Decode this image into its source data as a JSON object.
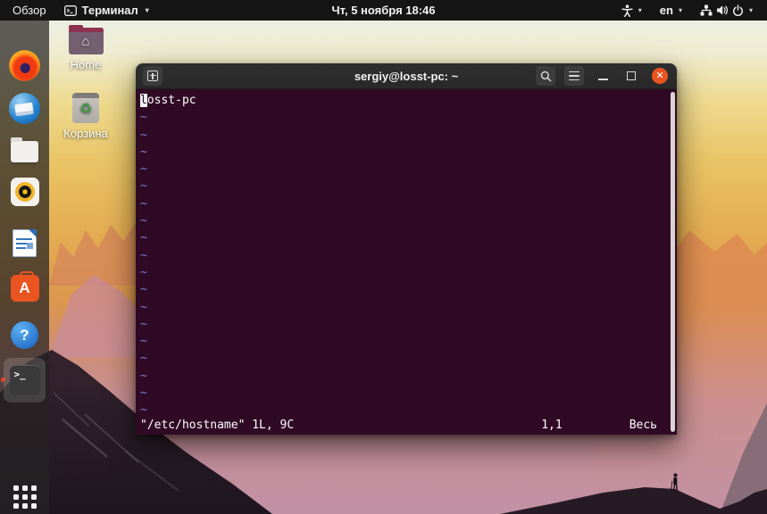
{
  "colors": {
    "terminal_background": "#300a24",
    "close_button": "#e95420",
    "tilde": "#7f7fd0",
    "top_bar": "#0d0d0d"
  },
  "top_bar": {
    "activities": "Обзор",
    "app_menu": "Терминал",
    "clock": "Чт, 5 ноября 18:46",
    "keyboard_layout": "en",
    "caret": "▾"
  },
  "desktop": {
    "icons": [
      {
        "label": "Home"
      },
      {
        "label": "Корзина"
      }
    ]
  },
  "dock": {
    "items": [
      "firefox",
      "thunderbird",
      "files",
      "rhythmbox",
      "libreoffice-writer",
      "ubuntu-software",
      "help",
      "terminal"
    ],
    "active_item": "terminal"
  },
  "icons": {
    "house": "⌂",
    "recycle": "♻",
    "terminal_prompt": ">_",
    "ubuntu_software_letter": "A",
    "help_mark": "?",
    "close_glyph": "✕"
  },
  "terminal_window": {
    "title": "sergiy@losst-pc: ~",
    "vim": {
      "cursor_char": "l",
      "line1_rest": "osst-pc",
      "tilde_char": "~",
      "tilde_count": 18,
      "status": {
        "file_info": "\"/etc/hostname\" 1L, 9C",
        "position": "1,1",
        "scroll": "Весь"
      }
    }
  }
}
